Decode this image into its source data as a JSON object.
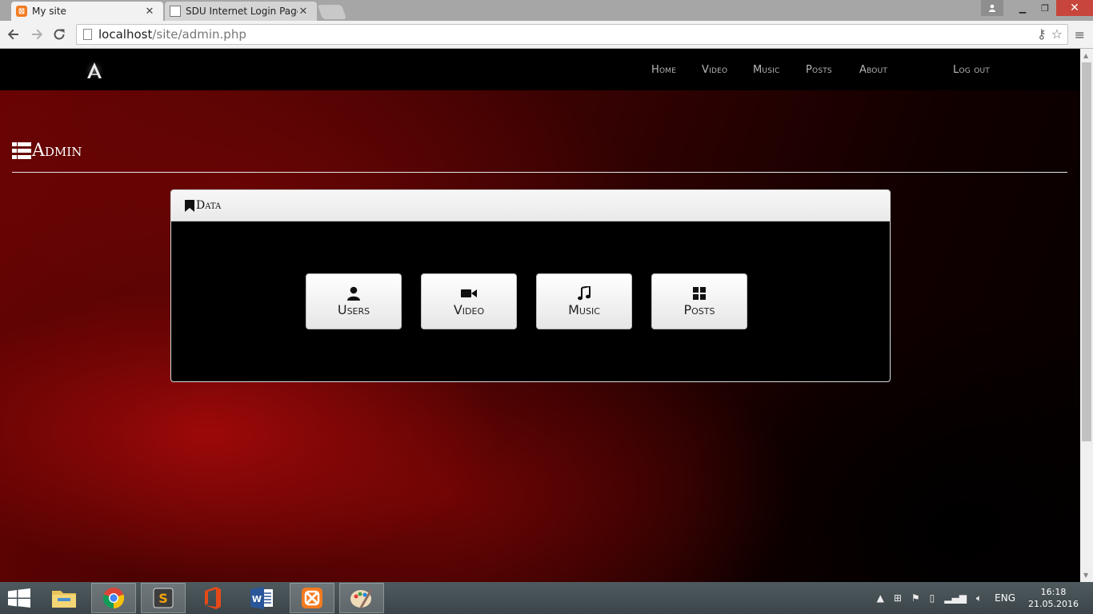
{
  "browser": {
    "tabs": [
      {
        "title": "My site",
        "active": true,
        "favicon": "xampp-icon"
      },
      {
        "title": "SDU Internet Login Page",
        "active": false,
        "favicon": "page-icon"
      }
    ],
    "url_host": "localhost",
    "url_path": "/site/admin.php"
  },
  "site": {
    "nav": [
      "Home",
      "Video",
      "Music",
      "Posts",
      "About"
    ],
    "logout_label": "Log out",
    "page_title": "Admin",
    "panel_title": "Data",
    "tiles": [
      {
        "label": "Users",
        "icon": "user-icon"
      },
      {
        "label": "Video",
        "icon": "video-camera-icon"
      },
      {
        "label": "Music",
        "icon": "music-note-icon"
      },
      {
        "label": "Posts",
        "icon": "grid-icon"
      }
    ]
  },
  "taskbar": {
    "apps": [
      "file-explorer-icon",
      "chrome-icon",
      "sublime-text-icon",
      "office-icon",
      "word-icon",
      "xampp-icon",
      "paint-icon"
    ],
    "language": "ENG",
    "time": "16:18",
    "date": "21.05.2016"
  },
  "colors": {
    "accent_red": "#8b0000",
    "nav_bg": "#000000",
    "panel_heading_bg": "#efefef",
    "window_close": "#c7453c"
  }
}
